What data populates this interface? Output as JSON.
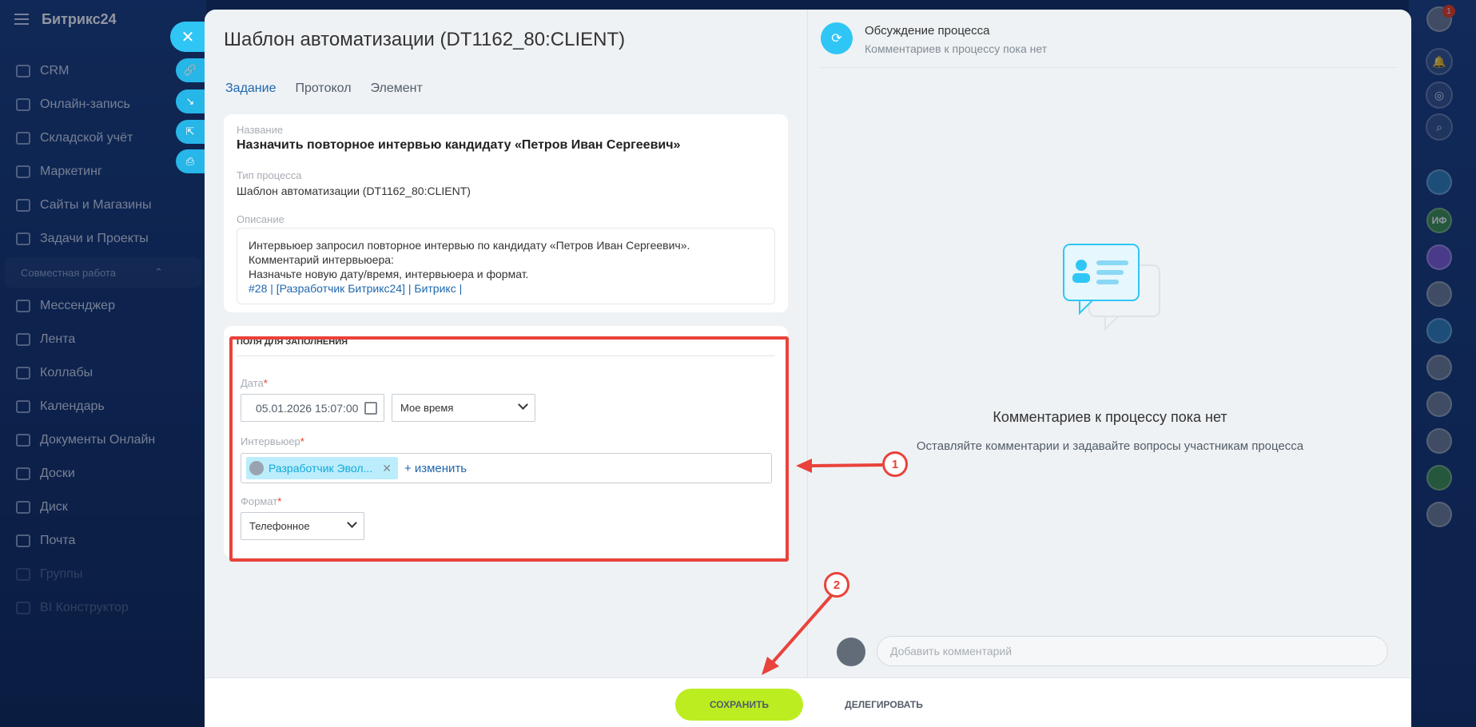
{
  "sidebar": {
    "brand": "Битрикс24",
    "items": [
      {
        "label": "CRM"
      },
      {
        "label": "Онлайн-запись"
      },
      {
        "label": "Складской учёт"
      },
      {
        "label": "Маркетинг"
      },
      {
        "label": "Сайты и Магазины"
      },
      {
        "label": "Задачи и Проекты"
      }
    ],
    "group_label": "Совместная работа",
    "group_items": [
      {
        "label": "Мессенджер"
      },
      {
        "label": "Лента"
      },
      {
        "label": "Коллабы"
      },
      {
        "label": "Календарь"
      },
      {
        "label": "Документы Онлайн"
      },
      {
        "label": "Доски"
      },
      {
        "label": "Диск"
      },
      {
        "label": "Почта"
      },
      {
        "label": "Группы"
      },
      {
        "label": "BI Конструктор"
      }
    ]
  },
  "right_rail": {
    "notification_count": "1",
    "avatar_initials": "ИФ"
  },
  "task": {
    "title": "Шаблон автоматизации (DT1162_80:CLIENT)",
    "tabs": [
      "Задание",
      "Протокол",
      "Элемент"
    ],
    "name_label": "Название",
    "name_value": "Назначить повторное интервью кандидату «Петров Иван Сергеевич»",
    "process_type_label": "Тип процесса",
    "process_type_value": "Шаблон автоматизации (DT1162_80:CLIENT)",
    "description_label": "Описание",
    "description_lines": [
      "Интервьюер запросил повторное интервью по кандидату «Петров Иван Сергеевич».",
      "Комментарий интервьюера:",
      "Назначьте новую дату/время, интервьюера и формат."
    ],
    "description_links": "#28 | [Разработчик Битрикс24] | Битрикс |"
  },
  "form": {
    "section_title": "ПОЛЯ ДЛЯ ЗАПОЛНЕНИЯ",
    "date_label": "Дата",
    "date_value": "05.01.2026 15:07:00",
    "timezone_value": "Мое время",
    "interviewer_label": "Интервьюер",
    "interviewer_tag": "Разработчик Эвол...",
    "change_link": "+ изменить",
    "format_label": "Формат",
    "format_value": "Телефонное",
    "required_mark": "*"
  },
  "discussion": {
    "title": "Обсуждение процесса",
    "subtitle": "Комментариев к процессу пока нет",
    "empty_title": "Комментариев к процессу пока нет",
    "empty_sub": "Оставляйте комментарии и задавайте вопросы участникам процесса",
    "comment_placeholder": "Добавить комментарий"
  },
  "footer": {
    "save_label": "СОХРАНИТЬ",
    "delegate_label": "ДЕЛЕГИРОВАТЬ"
  },
  "annotations": {
    "badge1": "1",
    "badge2": "2",
    "color": "#e9423a"
  },
  "colors": {
    "accent": "#2fc6f6",
    "link": "#2067b0",
    "save_button": "#bbed21"
  }
}
